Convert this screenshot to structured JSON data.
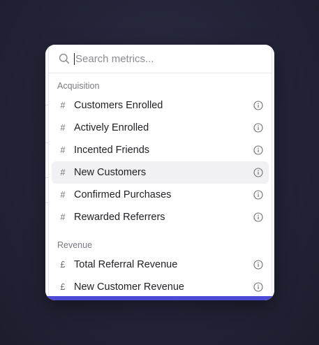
{
  "search": {
    "placeholder": "Search metrics...",
    "value": ""
  },
  "sections": [
    {
      "header": "Acquisition",
      "items": [
        {
          "glyph": "#",
          "label": "Customers Enrolled",
          "icon": "info-icon"
        },
        {
          "glyph": "#",
          "label": "Actively Enrolled",
          "icon": "info-icon"
        },
        {
          "glyph": "#",
          "label": "Incented Friends",
          "icon": "info-icon"
        },
        {
          "glyph": "#",
          "label": "New Customers",
          "icon": "info-icon",
          "highlighted": true
        },
        {
          "glyph": "#",
          "label": "Confirmed Purchases",
          "icon": "info-icon"
        },
        {
          "glyph": "#",
          "label": "Rewarded Referrers",
          "icon": "info-icon"
        }
      ]
    },
    {
      "header": "Revenue",
      "items": [
        {
          "glyph": "£",
          "label": "Total Referral Revenue",
          "icon": "info-icon"
        },
        {
          "glyph": "£",
          "label": "New Customer Revenue",
          "icon": "info-icon"
        }
      ]
    }
  ],
  "colors": {
    "accent": "#4d4ad6",
    "highlight": "#f1f1f3",
    "backdrop": "#24253a"
  }
}
